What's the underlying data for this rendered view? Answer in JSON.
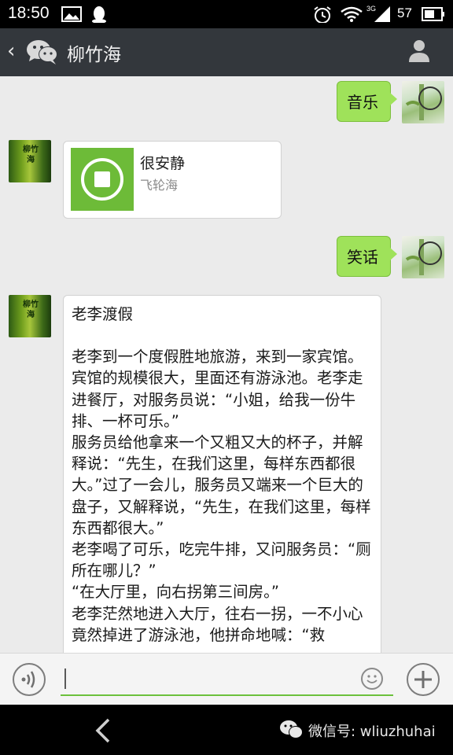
{
  "status_bar": {
    "time": "18:50",
    "network": "3G",
    "battery": "57",
    "icons": [
      "image-icon",
      "qq-icon",
      "alarm-icon",
      "wifi-icon",
      "signal-icon",
      "battery-icon"
    ]
  },
  "header": {
    "back_icon": "‹",
    "title": "柳竹海",
    "app_icon": "wechat-icon",
    "profile_icon": "person-icon"
  },
  "messages": [
    {
      "type": "text",
      "side": "right",
      "text": "音乐"
    },
    {
      "type": "music",
      "side": "left",
      "title": "很安静",
      "artist": "飞轮海"
    },
    {
      "type": "text",
      "side": "right",
      "text": "笑话"
    },
    {
      "type": "long-text",
      "side": "left",
      "title": "老李渡假",
      "body": "老李到一个度假胜地旅游，来到一家宾馆。宾馆的规模很大，里面还有游泳池。老李走进餐厅，对服务员说：“小姐，给我一份牛排、一杯可乐。”\n服务员给他拿来一个又粗又大的杯子，并解释说：“先生，在我们这里，每样东西都很大。”过了一会儿，服务员又端来一个巨大的盘子，又解释说，“先生，在我们这里，每样东西都很大。”\n老李喝了可乐，吃完牛排，又问服务员：“厕所在哪儿？”\n“在大厅里，向右拐第三间房。”\n老李茫然地进入大厅，往右一拐，一不小心竟然掉进了游泳池，他拼命地喊：“救"
    }
  ],
  "avatar_text": "柳竹海",
  "input_bar": {
    "value": "",
    "icons": [
      "voice-icon",
      "emoji-icon",
      "plus-icon"
    ]
  },
  "nav_bar": {
    "watermark": "微信号: wliuzhuhai"
  },
  "colors": {
    "header_bg": "#33373c",
    "chat_bg": "#ebebeb",
    "bubble_green": "#9fe25a",
    "accent_green": "#6cc13c"
  }
}
